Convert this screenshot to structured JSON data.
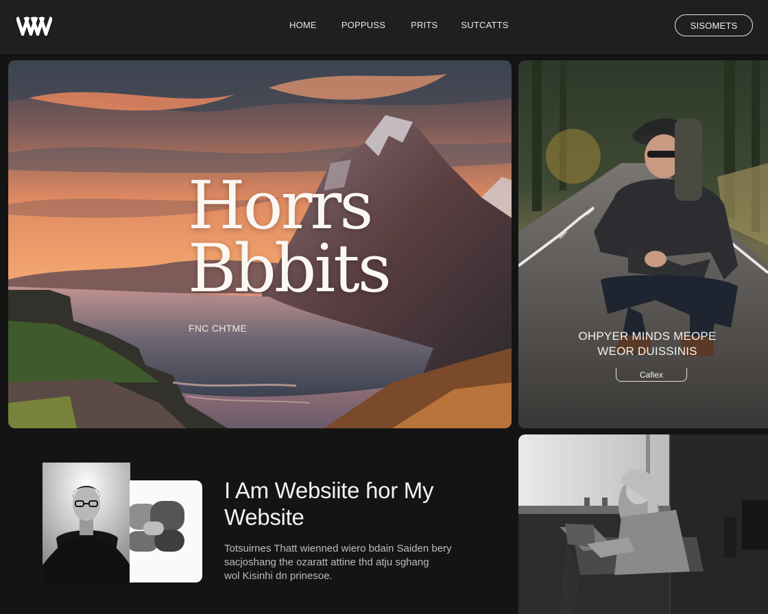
{
  "header": {
    "logo_icon": "ww-logo",
    "nav": [
      "HOME",
      "POPPUSS",
      "PRITS",
      "SUTCATTS"
    ],
    "cta_label": "SISOMETS"
  },
  "hero": {
    "title_line1": "Horrs",
    "title_line2": "Bbbits",
    "subtitle": "FNC CHTME",
    "image": "mountain-lake-sunset"
  },
  "feature": {
    "line1": "OHPYER MINDS MEOPE",
    "line2": "WEOR DUISSINIS",
    "button_label": "Cafiex",
    "image": "hiker-crouching-on-road"
  },
  "intro": {
    "title": "I Am Websiite ɦor My Website",
    "body": [
      "Totsuirnes Thatt wienned wiero bdain Saiden bery",
      "sacjoshang the ozaratt attine thd atju sghang",
      "wol Kisinhi dn prinesoe."
    ],
    "portrait_image": "man-with-glasses-portrait",
    "card_image": "abstract-blur"
  },
  "worker": {
    "image": "woman-working-on-laptop-by-window"
  },
  "colors": {
    "background": "#141414",
    "header": "#1f1f1f",
    "text": "#f2f2f2",
    "muted": "#bdbdbd"
  }
}
